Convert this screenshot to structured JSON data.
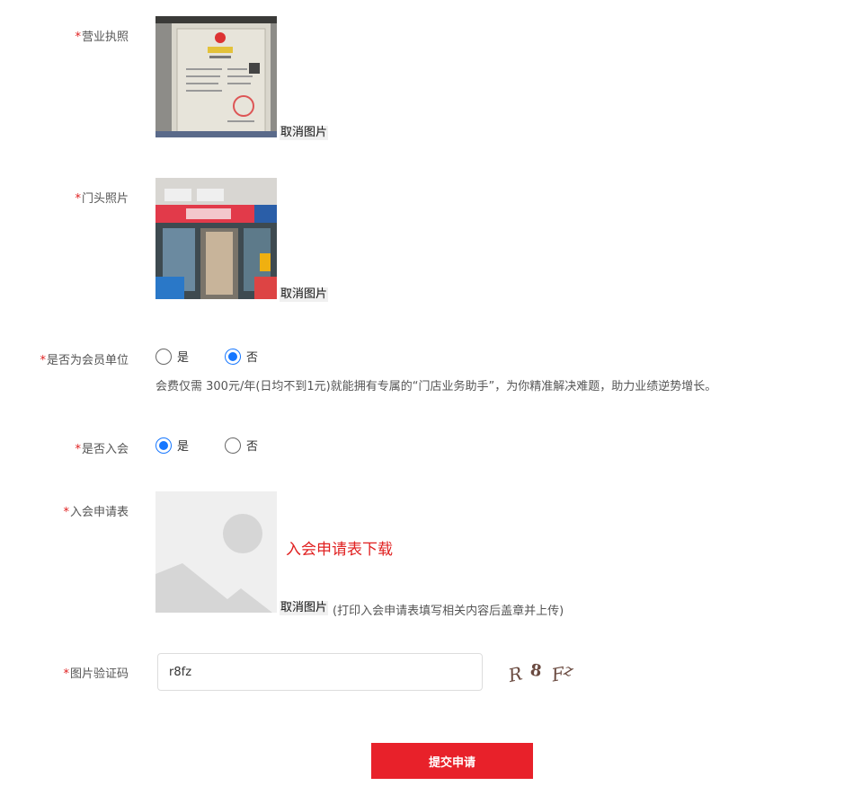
{
  "required_mark": "*",
  "business_license": {
    "label": "营业执照",
    "cancel_label": "取消图片"
  },
  "storefront_photo": {
    "label": "门头照片",
    "cancel_label": "取消图片"
  },
  "is_member": {
    "label": "是否为会员单位",
    "options": [
      "是",
      "否"
    ],
    "selected": "否",
    "note": "会费仅需 300元/年(日均不到1元)就能拥有专属的“门店业务助手”，为你精准解决难题，助力业绩逆势增长。"
  },
  "join": {
    "label": "是否入会",
    "options": [
      "是",
      "否"
    ],
    "selected": "是"
  },
  "application_form": {
    "label": "入会申请表",
    "download_label": "入会申请表下载",
    "cancel_label": "取消图片",
    "hint": "(打印入会申请表填写相关内容后盖章并上传)"
  },
  "captcha": {
    "label": "图片验证码",
    "value": "r8fz",
    "image_text": "R 8 Fz"
  },
  "submit_label": "提交申请",
  "colors": {
    "accent": "#e8212a",
    "radio_blue": "#1677ff",
    "required": "#e02020"
  }
}
